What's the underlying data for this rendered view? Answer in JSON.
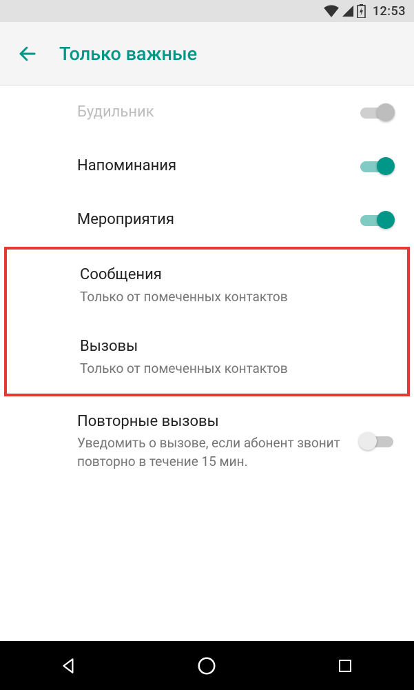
{
  "status": {
    "time": "12:53"
  },
  "header": {
    "title": "Только важные"
  },
  "items": {
    "alarm": {
      "label": "Будильник"
    },
    "reminders": {
      "label": "Напоминания"
    },
    "events": {
      "label": "Мероприятия"
    },
    "messages": {
      "label": "Сообщения",
      "sub": "Только от помеченных контактов"
    },
    "calls": {
      "label": "Вызовы",
      "sub": "Только от помеченных контактов"
    },
    "repeat": {
      "label": "Повторные вызовы",
      "sub": "Уведомить о вызове, если абонент звонит повторно в течение 15 мин."
    }
  }
}
